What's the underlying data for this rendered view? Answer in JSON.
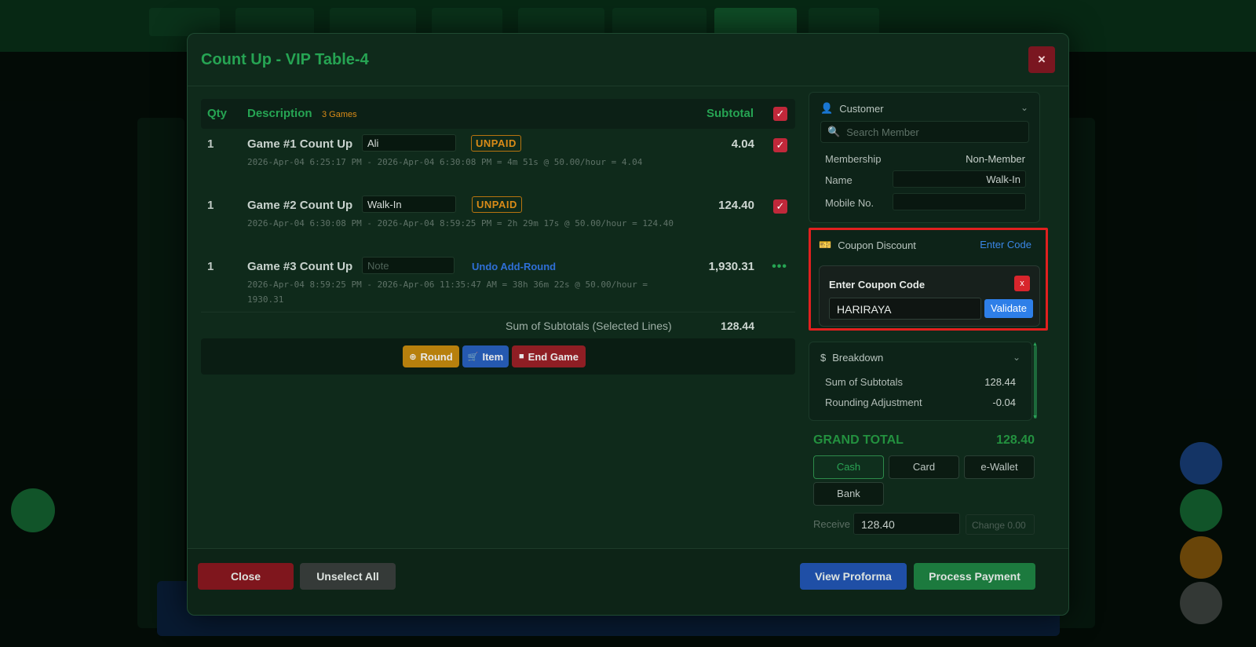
{
  "modal": {
    "title": "Count Up - VIP Table-4",
    "close_icon": "×"
  },
  "table": {
    "headers": {
      "qty": "Qty",
      "description": "Description",
      "games_badge": "3 Games",
      "subtotal": "Subtotal"
    },
    "rows": [
      {
        "qty": "1",
        "name": "Game #1  Count Up",
        "field": "Ali",
        "status": "UNPAID",
        "detail": "2026-Apr-04 6:25:17 PM - 2026-Apr-04 6:30:08 PM = 4m 51s @ 50.00/hour = 4.04",
        "subtotal": "4.04"
      },
      {
        "qty": "1",
        "name": "Game #2  Count Up",
        "field": "Walk-In",
        "status": "UNPAID",
        "detail": "2026-Apr-04 6:30:08 PM - 2026-Apr-04 8:59:25 PM = 2h 29m 17s @ 50.00/hour = 124.40",
        "subtotal": "124.40"
      },
      {
        "qty": "1",
        "name": "Game #3  Count Up",
        "field_placeholder": "Note",
        "action": "Undo Add-Round",
        "detail": "2026-Apr-04 8:59:25 PM - 2026-Apr-06 11:35:47 AM = 38h 36m 22s @ 50.00/hour = 1930.31",
        "subtotal": "1,930.31",
        "more": "•••"
      }
    ],
    "sum_label": "Sum of Subtotals (Selected Lines)",
    "sum_value": "128.44",
    "actions": {
      "round": "Round",
      "item": "Item",
      "end_game": "End Game"
    }
  },
  "customer": {
    "title": "Customer",
    "search_placeholder": "Search Member",
    "membership_label": "Membership",
    "membership_value": "Non-Member",
    "name_label": "Name",
    "name_value": "Walk-In",
    "mobile_label": "Mobile No.",
    "mobile_value": ""
  },
  "coupon": {
    "title": "Coupon Discount",
    "enter_code": "Enter Code",
    "popup_title": "Enter Coupon Code",
    "popup_close": "x",
    "code_value": "HARIRAYA",
    "validate": "Validate"
  },
  "breakdown": {
    "title": "Breakdown",
    "sum_label": "Sum of Subtotals",
    "sum_value": "128.44",
    "rounding_label": "Rounding Adjustment",
    "rounding_value": "-0.04"
  },
  "payment": {
    "grand_label": "GRAND TOTAL",
    "grand_value": "128.40",
    "methods": [
      "Cash",
      "Card",
      "e-Wallet",
      "Bank"
    ],
    "receive_label": "Receive",
    "receive_value": "128.40",
    "change_label": "Change 0.00"
  },
  "footer": {
    "close": "Close",
    "unselect_all": "Unselect All",
    "view_proforma": "View Proforma",
    "process_payment": "Process Payment"
  },
  "colors": {
    "accent_green": "#26a453",
    "danger_red": "#c0283a",
    "primary_blue": "#2e7fe8",
    "warning_orange": "#d98b18",
    "highlight_red": "#e0201f"
  }
}
